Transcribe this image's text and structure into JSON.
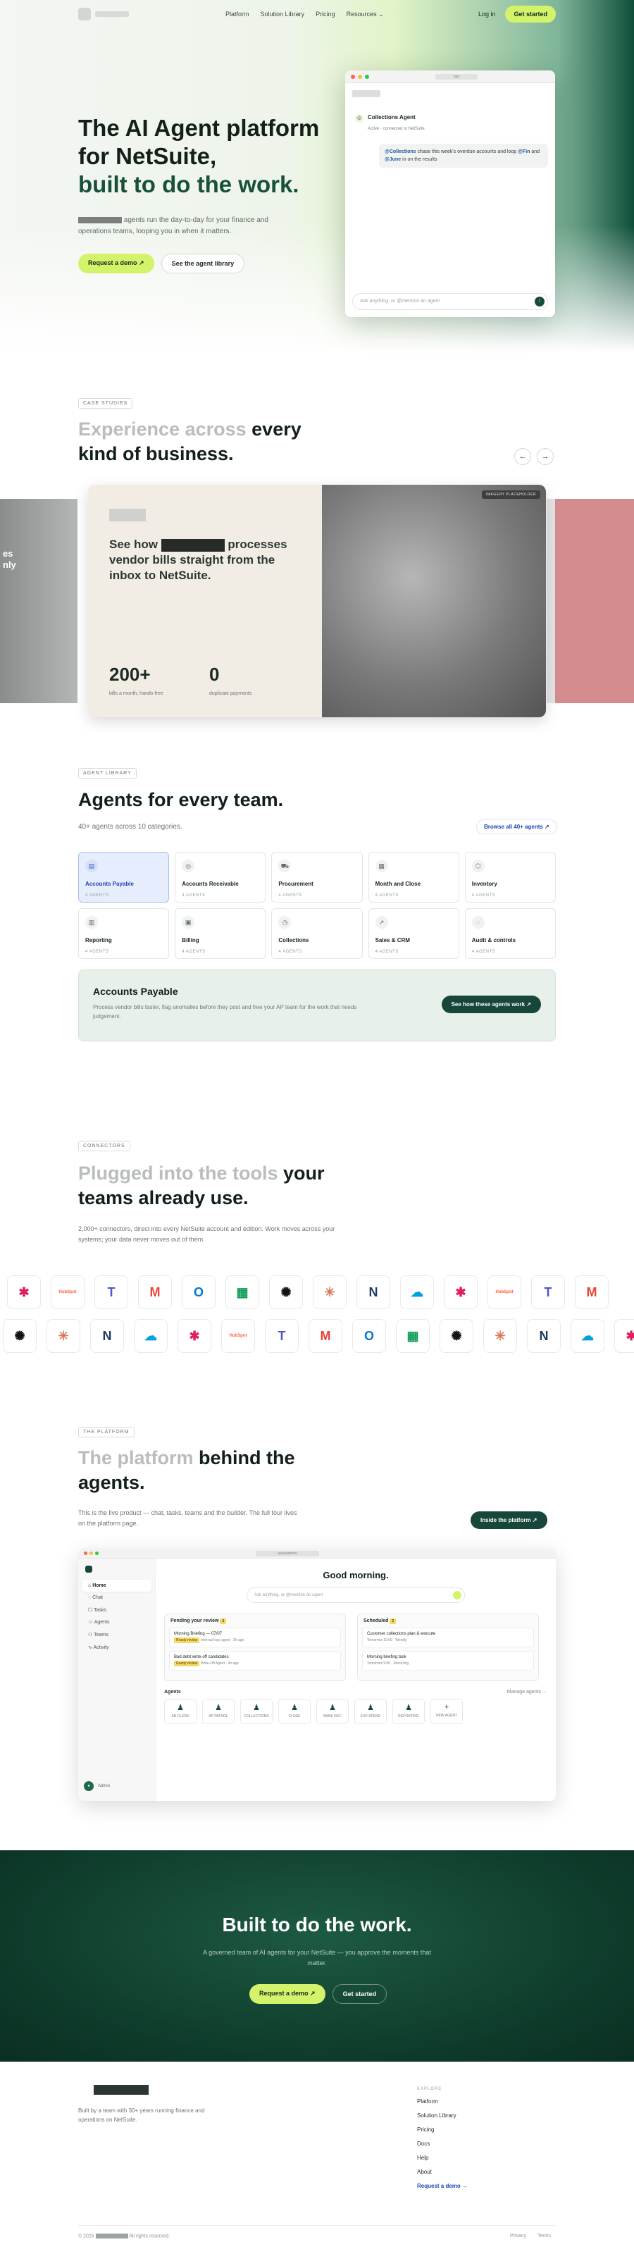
{
  "header": {
    "nav": [
      "Platform",
      "Solution Library",
      "Pricing",
      "Resources"
    ],
    "login": "Log in",
    "start": "Get started"
  },
  "hero": {
    "line1": "The AI Agent platform",
    "line2": "for NetSuite,",
    "line3": "built to do the work.",
    "desc": " agents run the day-to-day for your finance and operations teams, looping you in when it matters.",
    "demo": "Request a demo ↗",
    "library": "See the agent library",
    "window": {
      "url": "app",
      "agent": "Collections Agent",
      "status": "Active · connected to NetSuite",
      "msg_a": "@Collections",
      "msg_b": " chase this week's overdue accounts and loop ",
      "msg_c": "@Fin",
      "msg_d": " and ",
      "msg_e": "@June",
      "msg_f": " in on the results",
      "ask": "Ask anything, or @mention an agent",
      "send": "↑"
    }
  },
  "cases": {
    "eyebrow": "CASE STUDIES",
    "title_mute": "Experience across",
    "title": " every kind of business.",
    "prev": "←",
    "next": "→",
    "side_l": "es\nnly",
    "headline_a": "See how",
    "headline_b": " processes vendor bills straight from the inbox to NetSuite.",
    "tag": "IMAGERY PLACEHOLDER",
    "s1v": "200+",
    "s1l": "bills a month, hands-free",
    "s2v": "0",
    "s2l": "duplicate payments"
  },
  "library": {
    "eyebrow": "AGENT LIBRARY",
    "title": "Agents for every team.",
    "sub": "40+ agents across 10 categories.",
    "browse": "Browse all 40+ agents ↗",
    "cats": [
      {
        "n": "Accounts Payable",
        "c": "4 AGENTS",
        "i": "▤"
      },
      {
        "n": "Accounts Receivable",
        "c": "4 AGENTS",
        "i": "◎"
      },
      {
        "n": "Procurement",
        "c": "4 AGENTS",
        "i": "⛟"
      },
      {
        "n": "Month and Close",
        "c": "4 AGENTS",
        "i": "▦"
      },
      {
        "n": "Inventory",
        "c": "4 AGENTS",
        "i": "⬡"
      },
      {
        "n": "Reporting",
        "c": "4 AGENTS",
        "i": "▥"
      },
      {
        "n": "Billing",
        "c": "4 AGENTS",
        "i": "▣"
      },
      {
        "n": "Collections",
        "c": "4 AGENTS",
        "i": "◷"
      },
      {
        "n": "Sales & CRM",
        "c": "4 AGENTS",
        "i": "↗"
      },
      {
        "n": "Audit & controls",
        "c": "4 AGENTS",
        "i": "◌"
      }
    ],
    "ap_title": "Accounts Payable",
    "ap_desc": "Process vendor bills faster, flag anomalies before they post and free your AP team for the work that needs judgement.",
    "ap_btn": "See how these agents work ↗"
  },
  "connectors": {
    "eyebrow": "CONNECTORS",
    "title_mute": "Plugged into the tools",
    "title": " your teams already use.",
    "sub": "2,000+ connectors, direct into every NetSuite account and edition. Work moves across your systems; your data never moves out of them.",
    "row1": [
      "slack",
      "hubspot",
      "teams",
      "gmail",
      "outlook",
      "sheets",
      "openai",
      "claude",
      "notion",
      "salesforce",
      "slack",
      "hubspot",
      "teams",
      "gmail"
    ],
    "row2": [
      "openai",
      "claude",
      "notion",
      "salesforce",
      "slack",
      "hubspot",
      "teams",
      "gmail",
      "outlook",
      "sheets",
      "openai",
      "claude",
      "notion",
      "salesforce",
      "slack"
    ]
  },
  "platform": {
    "eyebrow": "THE PLATFORM",
    "title_mute": "The platform",
    "title": " behind the agents.",
    "sub": "This is the live product — chat, tasks, teams and the builder. The full tour lives on the platform page.",
    "btn": "Inside the platform ↗",
    "app": {
      "url": "app/platform",
      "nav": [
        "Home",
        "Chat",
        "Tasks",
        "Agents",
        "Teams",
        "Activity"
      ],
      "greet": "Good morning.",
      "ask": "Ask anything, or @mention an agent",
      "review": "Pending your review",
      "review_n": "2",
      "r1": "Morning Briefing — 07/07",
      "r1b": "Ready review",
      "r1s": "Internal Ingo agent · 2h ago",
      "r2": "Bad debt write-off candidates",
      "r2b": "Ready review",
      "r2s": "Write-Off Agent · 4h ago",
      "sched": "Scheduled",
      "sched_n": "2",
      "s1": "Customer collections plan & execute",
      "s1s": "Tomorrow 10:00 · Weekly",
      "s2": "Morning briefing task",
      "s2s": "Tomorrow 9:00 · Recurring",
      "agents": "Agents",
      "manage": "Manage agents →",
      "alist": [
        "AR CLERK",
        "AP PATROL",
        "COLLECTIONS",
        "CLOSE",
        "BANK REC",
        "EXP SPEND",
        "REPORTING",
        "NEW AGENT"
      ],
      "user": "Admin"
    }
  },
  "cta": {
    "title": "Built to do the work.",
    "desc": "A governed team of AI agents for your NetSuite — you approve the moments that matter.",
    "demo": "Request a demo ↗",
    "start": "Get started"
  },
  "footer": {
    "desc": "Built by a team with 30+ years running finance and operations on NetSuite.",
    "explore": "EXPLORE",
    "links": [
      "Platform",
      "Solution Library",
      "Pricing",
      "Docs",
      "Help",
      "About"
    ],
    "request": "Request a demo →",
    "copy_a": "© 2025",
    "copy_b": " All rights reserved.",
    "privacy": "Privacy",
    "terms": "Terms"
  }
}
